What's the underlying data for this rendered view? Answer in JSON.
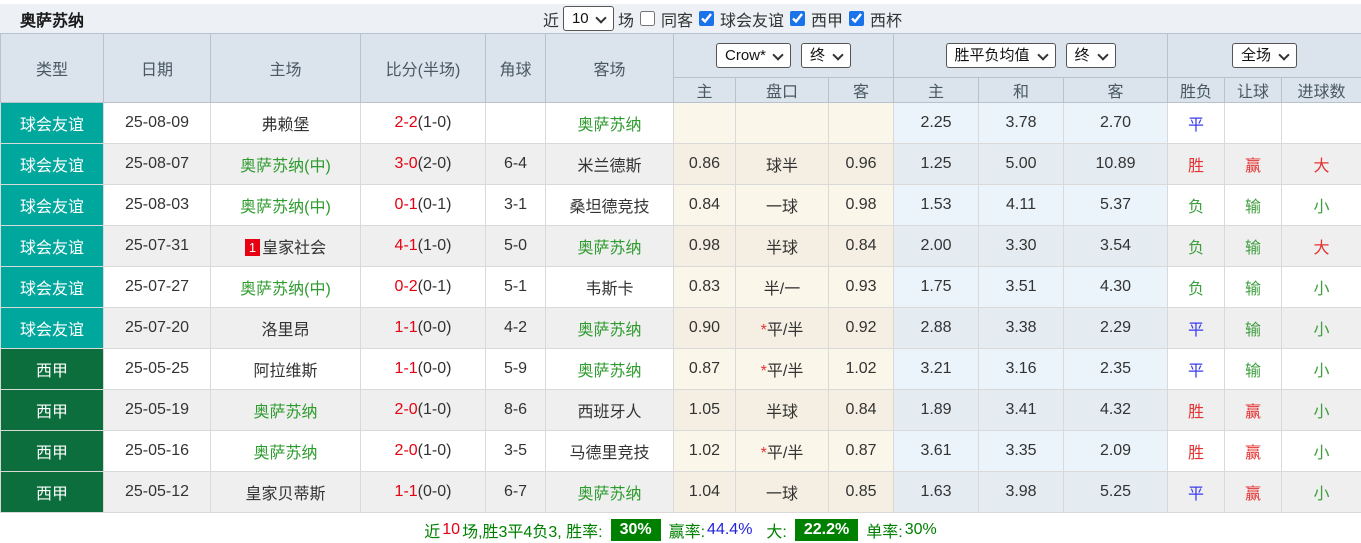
{
  "topbar": {
    "team_title": "奥萨苏纳",
    "recent_label": "近",
    "recent_value": "10",
    "games_label": "场",
    "same_opponent": {
      "label": "同客",
      "checked": false
    },
    "league_filters": [
      {
        "label": "球会友谊",
        "checked": true
      },
      {
        "label": "西甲",
        "checked": true
      },
      {
        "label": "西杯",
        "checked": true
      }
    ]
  },
  "header": {
    "type": "类型",
    "date": "日期",
    "home": "主场",
    "score": "比分(半场)",
    "corner": "角球",
    "away": "客场",
    "handicap_company_select": "Crow*",
    "handicap_final_select": "终",
    "odds_select": "胜平负均值",
    "odds_final_select": "终",
    "fulltime_select": "全场",
    "sub": {
      "h_home": "主",
      "h_line": "盘口",
      "h_away": "客",
      "o_home": "主",
      "o_draw": "和",
      "o_away": "客",
      "result": "胜负",
      "handicap_result": "让球",
      "goals": "进球数"
    }
  },
  "rows": [
    {
      "type": "球会友谊",
      "date": "25-08-09",
      "home": "弗赖堡",
      "home_self": false,
      "home_badge": "",
      "score_ft": "2-2",
      "score_ht": "(1-0)",
      "corner": "",
      "away": "奥萨苏纳",
      "away_self": true,
      "h_home": "",
      "h_line": "",
      "h_away": "",
      "o_home": "2.25",
      "o_draw": "3.78",
      "o_away": "2.70",
      "result": "平",
      "handicap_result": "",
      "goals": ""
    },
    {
      "type": "球会友谊",
      "date": "25-08-07",
      "home": "奥萨苏纳(中)",
      "home_self": true,
      "home_badge": "",
      "score_ft": "3-0",
      "score_ht": "(2-0)",
      "corner": "6-4",
      "away": "米兰德斯",
      "away_self": false,
      "h_home": "0.86",
      "h_line": "球半",
      "h_away": "0.96",
      "o_home": "1.25",
      "o_draw": "5.00",
      "o_away": "10.89",
      "result": "胜",
      "handicap_result": "赢",
      "goals": "大"
    },
    {
      "type": "球会友谊",
      "date": "25-08-03",
      "home": "奥萨苏纳(中)",
      "home_self": true,
      "home_badge": "",
      "score_ft": "0-1",
      "score_ht": "(0-1)",
      "corner": "3-1",
      "away": "桑坦德竞技",
      "away_self": false,
      "h_home": "0.84",
      "h_line": "一球",
      "h_away": "0.98",
      "o_home": "1.53",
      "o_draw": "4.11",
      "o_away": "5.37",
      "result": "负",
      "handicap_result": "输",
      "goals": "小"
    },
    {
      "type": "球会友谊",
      "date": "25-07-31",
      "home": "皇家社会",
      "home_self": false,
      "home_badge": "1",
      "score_ft": "4-1",
      "score_ht": "(1-0)",
      "corner": "5-0",
      "away": "奥萨苏纳",
      "away_self": true,
      "h_home": "0.98",
      "h_line": "半球",
      "h_away": "0.84",
      "o_home": "2.00",
      "o_draw": "3.30",
      "o_away": "3.54",
      "result": "负",
      "handicap_result": "输",
      "goals": "大"
    },
    {
      "type": "球会友谊",
      "date": "25-07-27",
      "home": "奥萨苏纳(中)",
      "home_self": true,
      "home_badge": "",
      "score_ft": "0-2",
      "score_ht": "(0-1)",
      "corner": "5-1",
      "away": "韦斯卡",
      "away_self": false,
      "h_home": "0.83",
      "h_line": "半/一",
      "h_away": "0.93",
      "o_home": "1.75",
      "o_draw": "3.51",
      "o_away": "4.30",
      "result": "负",
      "handicap_result": "输",
      "goals": "小"
    },
    {
      "type": "球会友谊",
      "date": "25-07-20",
      "home": "洛里昂",
      "home_self": false,
      "home_badge": "",
      "score_ft": "1-1",
      "score_ht": "(0-0)",
      "corner": "4-2",
      "away": "奥萨苏纳",
      "away_self": true,
      "h_home": "0.90",
      "h_line": "*平/半",
      "h_away": "0.92",
      "o_home": "2.88",
      "o_draw": "3.38",
      "o_away": "2.29",
      "result": "平",
      "handicap_result": "输",
      "goals": "小"
    },
    {
      "type": "西甲",
      "date": "25-05-25",
      "home": "阿拉维斯",
      "home_self": false,
      "home_badge": "",
      "score_ft": "1-1",
      "score_ht": "(0-0)",
      "corner": "5-9",
      "away": "奥萨苏纳",
      "away_self": true,
      "h_home": "0.87",
      "h_line": "*平/半",
      "h_away": "1.02",
      "o_home": "3.21",
      "o_draw": "3.16",
      "o_away": "2.35",
      "result": "平",
      "handicap_result": "输",
      "goals": "小"
    },
    {
      "type": "西甲",
      "date": "25-05-19",
      "home": "奥萨苏纳",
      "home_self": true,
      "home_badge": "",
      "score_ft": "2-0",
      "score_ht": "(1-0)",
      "corner": "8-6",
      "away": "西班牙人",
      "away_self": false,
      "h_home": "1.05",
      "h_line": "半球",
      "h_away": "0.84",
      "o_home": "1.89",
      "o_draw": "3.41",
      "o_away": "4.32",
      "result": "胜",
      "handicap_result": "赢",
      "goals": "小"
    },
    {
      "type": "西甲",
      "date": "25-05-16",
      "home": "奥萨苏纳",
      "home_self": true,
      "home_badge": "",
      "score_ft": "2-0",
      "score_ht": "(1-0)",
      "corner": "3-5",
      "away": "马德里竞技",
      "away_self": false,
      "h_home": "1.02",
      "h_line": "*平/半",
      "h_away": "0.87",
      "o_home": "3.61",
      "o_draw": "3.35",
      "o_away": "2.09",
      "result": "胜",
      "handicap_result": "赢",
      "goals": "小"
    },
    {
      "type": "西甲",
      "date": "25-05-12",
      "home": "皇家贝蒂斯",
      "home_self": false,
      "home_badge": "",
      "score_ft": "1-1",
      "score_ht": "(0-0)",
      "corner": "6-7",
      "away": "奥萨苏纳",
      "away_self": true,
      "h_home": "1.04",
      "h_line": "一球",
      "h_away": "0.85",
      "o_home": "1.63",
      "o_draw": "3.98",
      "o_away": "5.25",
      "result": "平",
      "handicap_result": "赢",
      "goals": "小"
    }
  ],
  "footer": {
    "recent_prefix": "近",
    "recent_count": "10",
    "summary": "场,胜3平4负3, 胜率:",
    "win_rate_badge": "30%",
    "win_odds_label": "赢率:",
    "win_odds_value": "44.4%",
    "big_label": "大:",
    "big_badge": "22.2%",
    "single_label": "单率:",
    "single_value": "30%"
  },
  "colors": {
    "friendly_bg": "#00a79d",
    "league_bg": "#0b6e3c",
    "self_team": "#2e9b2e",
    "score_red": "#e60012",
    "win_red": "#e53333",
    "draw_blue": "#3a3af0",
    "lose_green": "#3f9e3f",
    "badge_green": "#008000"
  }
}
